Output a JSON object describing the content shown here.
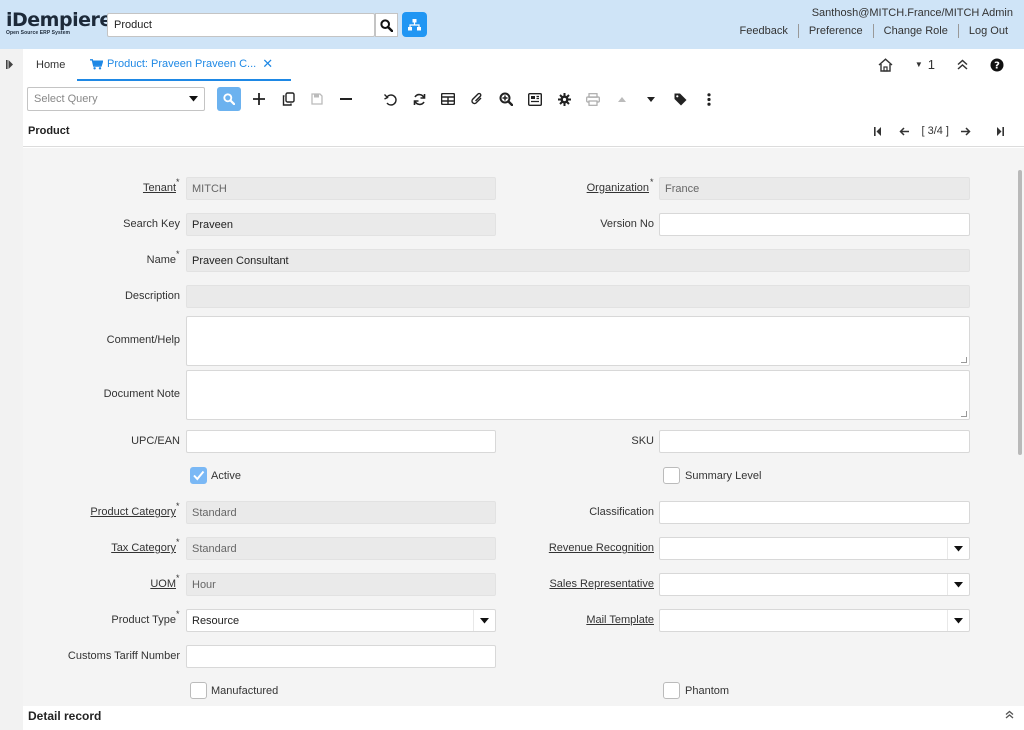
{
  "header": {
    "logo_main": "iDempiere",
    "logo_sub": "Open Source ERP System",
    "search_value": "Product",
    "user": "Santhosh@MITCH.France/MITCH Admin",
    "links": [
      "Feedback",
      "Preference",
      "Change Role",
      "Log Out"
    ]
  },
  "tabs": {
    "home": "Home",
    "active": "Product: Praveen Praveen C...",
    "count": "1"
  },
  "toolbar": {
    "query_placeholder": "Select Query"
  },
  "window": {
    "title": "Product",
    "record_nav": "[ 3/4 ]"
  },
  "form": {
    "tenant": {
      "label": "Tenant",
      "value": "MITCH"
    },
    "organization": {
      "label": "Organization",
      "value": "France"
    },
    "search_key": {
      "label": "Search Key",
      "value": "Praveen"
    },
    "version_no": {
      "label": "Version No",
      "value": ""
    },
    "name": {
      "label": "Name",
      "value": "Praveen Consultant"
    },
    "description": {
      "label": "Description",
      "value": ""
    },
    "comment_help": {
      "label": "Comment/Help",
      "value": ""
    },
    "document_note": {
      "label": "Document Note",
      "value": ""
    },
    "upc_ean": {
      "label": "UPC/EAN",
      "value": ""
    },
    "sku": {
      "label": "SKU",
      "value": ""
    },
    "active": {
      "label": "Active",
      "checked": true
    },
    "summary_level": {
      "label": "Summary Level",
      "checked": false
    },
    "product_category": {
      "label": "Product Category",
      "value": "Standard"
    },
    "classification": {
      "label": "Classification",
      "value": ""
    },
    "tax_category": {
      "label": "Tax Category",
      "value": "Standard"
    },
    "revenue_recognition": {
      "label": "Revenue Recognition",
      "value": ""
    },
    "uom": {
      "label": "UOM",
      "value": "Hour"
    },
    "sales_rep": {
      "label": "Sales Representative",
      "value": ""
    },
    "product_type": {
      "label": "Product Type",
      "value": "Resource"
    },
    "mail_template": {
      "label": "Mail Template",
      "value": ""
    },
    "customs_tariff": {
      "label": "Customs Tariff Number",
      "value": ""
    },
    "manufactured": {
      "label": "Manufactured",
      "checked": false
    },
    "phantom": {
      "label": "Phantom",
      "checked": false
    }
  },
  "detail": {
    "title": "Detail record"
  },
  "colors": {
    "header_bg": "#cfe4f7",
    "accent": "#1e88e5",
    "form_bg": "#f4f4f4"
  }
}
